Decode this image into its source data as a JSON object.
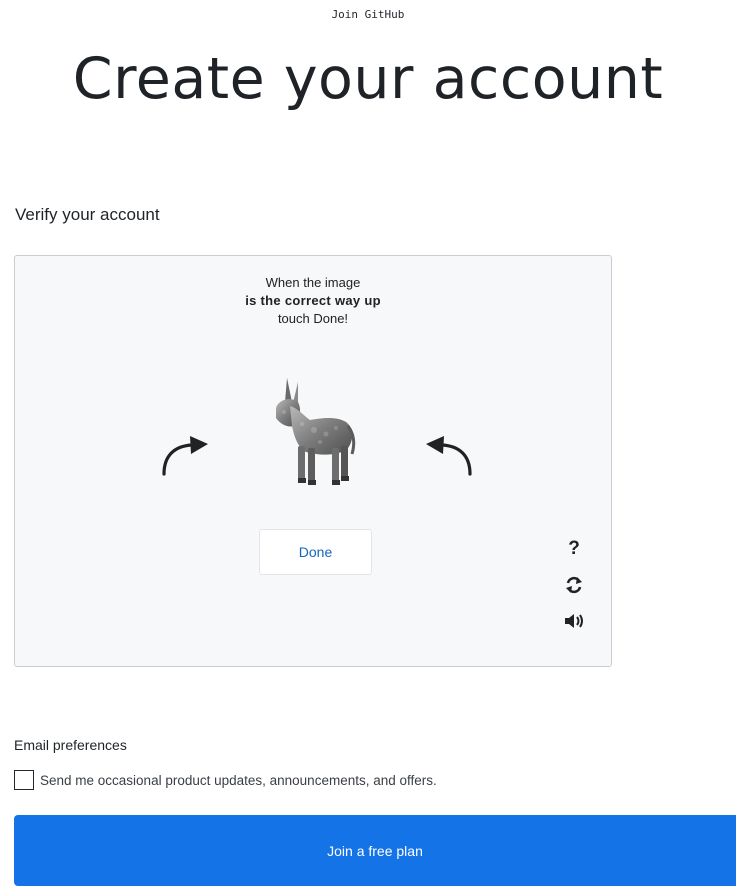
{
  "header": {
    "kicker": "Join GitHub",
    "title": "Create your account"
  },
  "verify": {
    "label": "Verify your account",
    "instruction_line1": "When the image",
    "instruction_line2": "is the correct way up",
    "instruction_line3": "touch Done!",
    "done_label": "Done",
    "help_glyph": "?"
  },
  "icons": {
    "rotate_left": "rotate-counterclockwise-arrow-icon",
    "rotate_right": "rotate-clockwise-arrow-icon",
    "puzzle": "donkey-image",
    "help": "question-mark-icon",
    "refresh": "refresh-icon",
    "audio": "speaker-audio-icon"
  },
  "email": {
    "label": "Email preferences",
    "checkbox_label": "Send me occasional product updates, announcements, and offers.",
    "checked": false
  },
  "submit": {
    "label": "Join a free plan"
  },
  "colors": {
    "primary_button": "#1473e6",
    "done_text": "#1565c0",
    "frame_bg": "#f7f8fa"
  }
}
